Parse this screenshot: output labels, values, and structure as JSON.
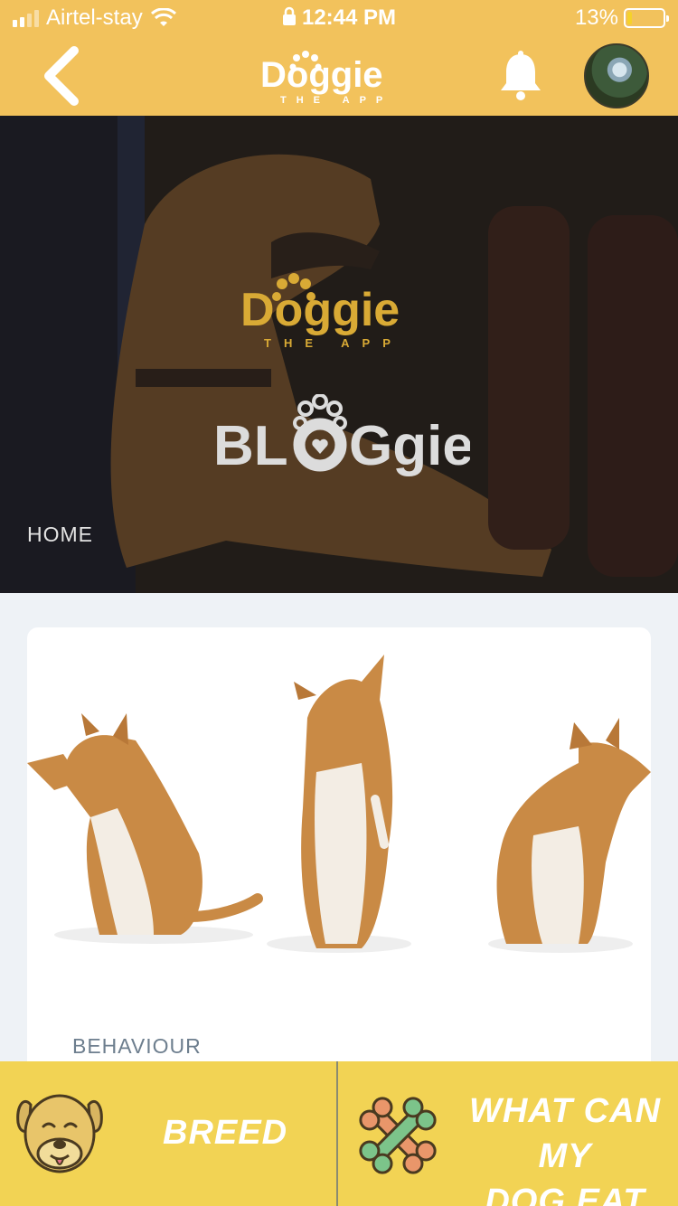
{
  "status_bar": {
    "carrier": "Airtel-stay",
    "time": "12:44 PM",
    "battery": "13%",
    "battery_level": 0.13
  },
  "header": {
    "logo_text": "Doggie",
    "logo_subtext": "THE APP",
    "back_icon": "chevron-left-icon",
    "bell_icon": "bell-icon",
    "avatar": "profile-avatar"
  },
  "hero": {
    "logo_text": "Doggie",
    "logo_subtext": "THE APP",
    "blog_text_left": "BL",
    "blog_text_right": "Ggie",
    "breadcrumb": "HOME"
  },
  "card": {
    "category": "BEHAVIOUR"
  },
  "bottom_nav": {
    "breed_label": "BREED",
    "eat_label_line1": "WHAT CAN MY",
    "eat_label_line2": "DOG EAT"
  },
  "colors": {
    "header_bg": "#f2c25c",
    "bottom_bg": "#f2d354",
    "logo_gold": "#d9aa35",
    "category_text": "#6d7e8e"
  }
}
